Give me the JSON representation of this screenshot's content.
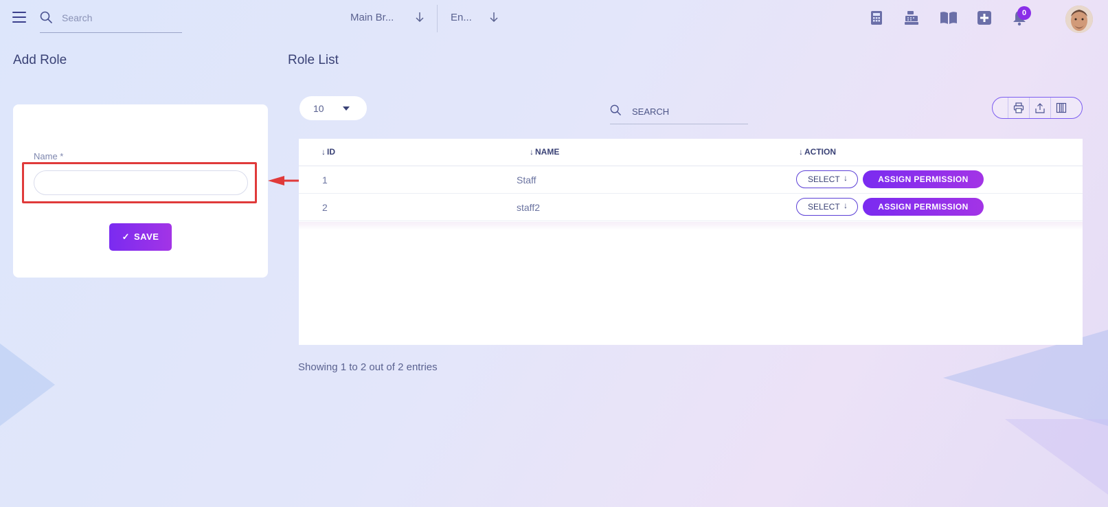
{
  "header": {
    "search_placeholder": "Search",
    "branch_label": "Main Br...",
    "language_label": "En...",
    "notification_count": "0",
    "icons": [
      "calculator-icon",
      "cash-register-icon",
      "book-icon",
      "plus-square-icon",
      "bell-icon"
    ]
  },
  "add_role": {
    "title": "Add Role",
    "name_label": "Name *",
    "name_value": "",
    "save_label": "SAVE"
  },
  "role_list": {
    "title": "Role List",
    "per_page": "10",
    "search_placeholder": "SEARCH",
    "columns": [
      "ID",
      "NAME",
      "ACTION"
    ],
    "rows": [
      {
        "id": "1",
        "name": "Staff",
        "select_label": "SELECT",
        "assign_label": "ASSIGN PERMISSION"
      },
      {
        "id": "2",
        "name": "staff2",
        "select_label": "SELECT",
        "assign_label": "ASSIGN PERMISSION"
      }
    ],
    "footer": "Showing 1 to 2 out of 2 entries"
  },
  "colors": {
    "accent": "#8a2fe8",
    "annotation": "#e03a3a",
    "text": "#3a4276"
  }
}
